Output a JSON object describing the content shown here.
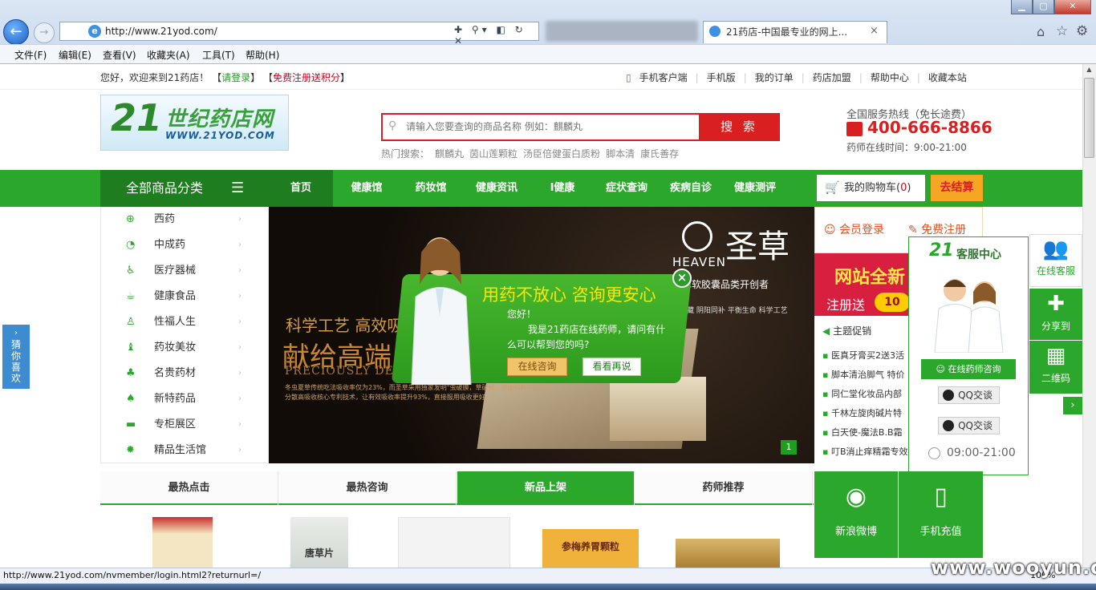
{
  "browser": {
    "url": "http://www.21yod.com/",
    "tab_title": "21药店-中国最专业的网上...",
    "tab_close": "×",
    "back_glyph": "←",
    "forward_glyph": "→",
    "addr_tools": "✚ ⚲▾ ◧ ↻ ✕",
    "menu": [
      "文件(F)",
      "编辑(E)",
      "查看(V)",
      "收藏夹(A)",
      "工具(T)",
      "帮助(H)"
    ],
    "window_controls": [
      "▁",
      "▢",
      "✕"
    ],
    "status_text": "http://www.21yod.com/nvmember/login.html2?returnurl=/",
    "zoom": "100%"
  },
  "topbar": {
    "welcome_prefix": "您好，欢迎来到21药店！",
    "login_link": "请登录",
    "register_link": "免费注册送积分",
    "bracket_open": "【",
    "bracket_close": "】",
    "links": [
      "手机客户端",
      "手机版",
      "我的订单",
      "药店加盟",
      "帮助中心",
      "收藏本站"
    ]
  },
  "header": {
    "logo_num": "21",
    "logo_cn": "世纪药店网",
    "logo_url": "WWW.21YOD.COM",
    "search_placeholder": "请输入您要查询的商品名称 例如：麒麟丸",
    "search_button": "搜 索",
    "hot_label": "热门搜索：",
    "hot_items": [
      "麒麟丸",
      "茵山莲颗粒",
      "汤臣倍健蛋白质粉",
      "脚本清",
      "康氏善存"
    ],
    "hotline_label": "全国服务热线（免长途费）",
    "hotline": "400-666-8866",
    "pharmacist_hours": "药师在线时间：9:00-21:00"
  },
  "nav": {
    "all_categories": "全部商品分类",
    "menu_icon": "☰",
    "items": [
      "首页",
      "健康馆",
      "药妆馆",
      "健康资讯",
      "I健康",
      "症状查询",
      "疾病自诊",
      "健康测评"
    ],
    "cart_label": "我的购物车(",
    "cart_count": "0",
    "cart_close": ")",
    "checkout": "去结算"
  },
  "categories": [
    {
      "icon": "pill-icon",
      "glyph": "⊕",
      "label": "西药"
    },
    {
      "icon": "leaf-icon",
      "glyph": "◔",
      "label": "中成药"
    },
    {
      "icon": "wheelchair-icon",
      "glyph": "♿",
      "label": "医疗器械"
    },
    {
      "icon": "cup-icon",
      "glyph": "☕",
      "label": "健康食品"
    },
    {
      "icon": "bottle-icon",
      "glyph": "♙",
      "label": "性福人生"
    },
    {
      "icon": "lipstick-icon",
      "glyph": "♝",
      "label": "药妆美妆"
    },
    {
      "icon": "clover-icon",
      "glyph": "♣",
      "label": "名贵药材"
    },
    {
      "icon": "maple-icon",
      "glyph": "♠",
      "label": "新特药品"
    },
    {
      "icon": "briefcase-icon",
      "glyph": "▬",
      "label": "专柜展区"
    },
    {
      "icon": "sun-icon",
      "glyph": "✹",
      "label": "精品生活馆"
    }
  ],
  "category_arrow": "›",
  "banner": {
    "line1": "科学工艺  高效吸",
    "line2": "献给高端",
    "line3": "PRECIOUSLY DEDI",
    "fine_print": "冬虫夏草传统吃法吸收率仅为23%，而圣草采用独家发明\"虫破膜，草破壁，溶出纯粹萃取\"高分散高吸收核心专利技术，让有效吸收率提升93%，直接服用吸收更好。",
    "brand_en": "HEAVEN",
    "brand_cn": "圣草",
    "subtitle": "夏草软胶囊品类开创者",
    "tagline": "于西藏  阴阳同补  平衡生命  科学工艺",
    "index": "1"
  },
  "popup": {
    "title": "用药不放心 咨询更安心",
    "greeting": "您好！",
    "message": "我是21药店在线药师，请问有什么可以帮到您的吗?",
    "consult_button": "在线咨询",
    "later_button": "看看再说",
    "close": "×"
  },
  "right_col": {
    "member_login": "会员登录",
    "free_register": "免费注册",
    "promo1": "网站全新",
    "promo2": "注册送",
    "promo_coin": "10",
    "news_header": "主题促销",
    "news": [
      "医真牙膏买2送3活",
      "脚本清治脚气 特价",
      "同仁堂化妆品内部",
      "千林左旋肉碱片特",
      "白天使-魔法B.B霜",
      "叮B消止痒精霜专效"
    ]
  },
  "service": {
    "title": "客服中心",
    "online_pharmacist": "在线药师咨询",
    "qq1": "QQ交谈",
    "qq2": "QQ交谈",
    "hours": "09:00-21:00"
  },
  "float_tabs": {
    "online_service": "在线客服",
    "share": "分享到",
    "qrcode": "二维码",
    "arrow": "›"
  },
  "guess": "猜你喜欢",
  "tabs": [
    "最热点击",
    "最热咨询",
    "新品上架",
    "药师推荐"
  ],
  "promo_tiles": {
    "weibo": "新浪微博",
    "phone": "手机充值"
  },
  "products": {
    "p2": "唐草片",
    "p4": "参梅养胃颗粒"
  },
  "watermark": "www.wooyun.org",
  "colors": {
    "brand_green": "#2ba82b",
    "accent_red": "#d91f1f",
    "orange": "#f5a623"
  }
}
